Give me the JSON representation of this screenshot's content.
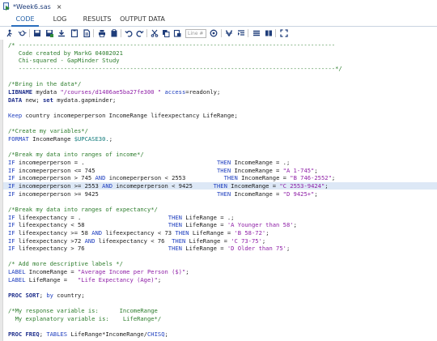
{
  "file_tab": {
    "title": "*Week6.sas",
    "close": "×"
  },
  "view_tabs": [
    "CODE",
    "LOG",
    "RESULTS",
    "OUTPUT DATA"
  ],
  "toolbar": {
    "line_placeholder": "Line #"
  },
  "colors": {
    "keyword": "#1f2f8c",
    "function": "#1f3fbf",
    "string": "#8e1ea6",
    "comment": "#2d7d2d",
    "format": "#117a7a",
    "highlight": "#dde8f6",
    "active_tab": "#2a6ebd"
  },
  "code_lines": [
    [
      [
        "cm",
        "/* -------------------------------------------------------------------------------------------"
      ]
    ],
    [
      [
        "cm",
        "   Code created by MarkG 04082021"
      ]
    ],
    [
      [
        "cm",
        "   Chi-squared - GapMinder Study"
      ]
    ],
    [
      [
        "cm",
        "   -------------------------------------------------------------------------------------------*/"
      ]
    ],
    [],
    [
      [
        "cm",
        "/*Bring in the data*/"
      ]
    ],
    [
      [
        "kw",
        "LIBNAME"
      ],
      [
        "tx",
        " mydata "
      ],
      [
        "st",
        "\"/courses/d1406ae5ba27fe300 \""
      ],
      [
        "tx",
        " "
      ],
      [
        "fn",
        "access"
      ],
      [
        "tx",
        "=readonly;"
      ]
    ],
    [
      [
        "kw",
        "DATA"
      ],
      [
        "tx",
        " new; "
      ],
      [
        "kw",
        "set"
      ],
      [
        "tx",
        " mydata.gapminder;"
      ]
    ],
    [],
    [
      [
        "fn",
        "Keep"
      ],
      [
        "tx",
        " country incomeperperson IncomeRange lifeexpectancy LifeRange;"
      ]
    ],
    [],
    [
      [
        "cm",
        "/*Create my variables*/"
      ]
    ],
    [
      [
        "fn",
        "FORMAT"
      ],
      [
        "tx",
        " IncomeRange "
      ],
      [
        "fmt",
        "$UPCASE30."
      ],
      [
        "tx",
        ";"
      ]
    ],
    [],
    [
      [
        "cm",
        "/*Break my data into ranges of income*/"
      ]
    ],
    [
      [
        "fn",
        "IF"
      ],
      [
        "tx",
        " incomeperperson = .                                      "
      ],
      [
        "fn",
        "THEN"
      ],
      [
        "tx",
        " IncomeRange = .;"
      ]
    ],
    [
      [
        "fn",
        "IF"
      ],
      [
        "tx",
        " incomeperperson <= 745                                   "
      ],
      [
        "fn",
        "THEN"
      ],
      [
        "tx",
        " IncomeRange = "
      ],
      [
        "st",
        "\"A 1-745\""
      ],
      [
        "tx",
        ";"
      ]
    ],
    [
      [
        "fn",
        "IF"
      ],
      [
        "tx",
        " incomeperperson > 745 "
      ],
      [
        "fn",
        "AND"
      ],
      [
        "tx",
        " incomeperperson < 2553           "
      ],
      [
        "fn",
        "THEN"
      ],
      [
        "tx",
        " IncomeRange = "
      ],
      [
        "st",
        "\"B 746-2552\""
      ],
      [
        "tx",
        ";"
      ]
    ],
    [
      [
        "fn",
        "IF"
      ],
      [
        "tx",
        " incomeperperson >= 2553 "
      ],
      [
        "fn",
        "AND"
      ],
      [
        "tx",
        " incomeperperson < 9425      "
      ],
      [
        "fn",
        "THEN"
      ],
      [
        "tx",
        " IncomeRange = "
      ],
      [
        "st",
        "\"C 2553-9424\""
      ],
      [
        "tx",
        ";"
      ]
    ],
    [
      [
        "fn",
        "IF"
      ],
      [
        "tx",
        " incomeperperson >= 9425                                  "
      ],
      [
        "fn",
        "THEN"
      ],
      [
        "tx",
        " IncomeRange = "
      ],
      [
        "st",
        "\"D 9425+\""
      ],
      [
        "tx",
        ";"
      ]
    ],
    [],
    [
      [
        "cm",
        "/*Break my data into ranges of expectancy*/"
      ]
    ],
    [
      [
        "fn",
        "IF"
      ],
      [
        "tx",
        " lifeexpectancy = .                         "
      ],
      [
        "fn",
        "THEN"
      ],
      [
        "tx",
        " LifeRange = .;"
      ]
    ],
    [
      [
        "fn",
        "IF"
      ],
      [
        "tx",
        " lifeexpectancy < 58                        "
      ],
      [
        "fn",
        "THEN"
      ],
      [
        "tx",
        " LifeRange = "
      ],
      [
        "st",
        "'A Younger than 58'"
      ],
      [
        "tx",
        ";"
      ]
    ],
    [
      [
        "fn",
        "IF"
      ],
      [
        "tx",
        " lifeexpectancy >= 58 "
      ],
      [
        "fn",
        "AND"
      ],
      [
        "tx",
        " lifeexpectancy < 73 "
      ],
      [
        "fn",
        "THEN"
      ],
      [
        "tx",
        " LifeRange = "
      ],
      [
        "st",
        "'B 58-72'"
      ],
      [
        "tx",
        ";"
      ]
    ],
    [
      [
        "fn",
        "IF"
      ],
      [
        "tx",
        " lifeexpectancy >72 "
      ],
      [
        "fn",
        "AND"
      ],
      [
        "tx",
        " lifeexpectancy < 76  "
      ],
      [
        "fn",
        "THEN"
      ],
      [
        "tx",
        " LifeRange = "
      ],
      [
        "st",
        "'C 73-75'"
      ],
      [
        "tx",
        ";"
      ]
    ],
    [
      [
        "fn",
        "IF"
      ],
      [
        "tx",
        " lifeexpectancy > 76                        "
      ],
      [
        "fn",
        "THEN"
      ],
      [
        "tx",
        " LifeRange = "
      ],
      [
        "st",
        "'D Older than 75'"
      ],
      [
        "tx",
        ";"
      ]
    ],
    [],
    [
      [
        "cm",
        "/* Add more descriptive labels */"
      ]
    ],
    [
      [
        "fn",
        "LABEL"
      ],
      [
        "tx",
        " IncomeRange = "
      ],
      [
        "st",
        "\"Average Income per Person ($)\""
      ],
      [
        "tx",
        ";"
      ]
    ],
    [
      [
        "fn",
        "LABEL"
      ],
      [
        "tx",
        " LifeRange =   "
      ],
      [
        "st",
        "\"Life Expectancy (Age)\""
      ],
      [
        "tx",
        ";"
      ]
    ],
    [],
    [
      [
        "kw",
        "PROC SORT"
      ],
      [
        "tx",
        "; "
      ],
      [
        "fn",
        "by"
      ],
      [
        "tx",
        " country;"
      ]
    ],
    [],
    [
      [
        "cm",
        "/*My response variable is:      IncomeRange"
      ]
    ],
    [
      [
        "cm",
        "  My explanatory variable is:    LifeRange*/"
      ]
    ],
    [],
    [
      [
        "kw",
        "PROC FREQ"
      ],
      [
        "tx",
        "; "
      ],
      [
        "fn",
        "TABLES"
      ],
      [
        "tx",
        " LifeRange*IncomeRange/"
      ],
      [
        "fn",
        "CHISQ"
      ],
      [
        "tx",
        ";"
      ]
    ]
  ]
}
